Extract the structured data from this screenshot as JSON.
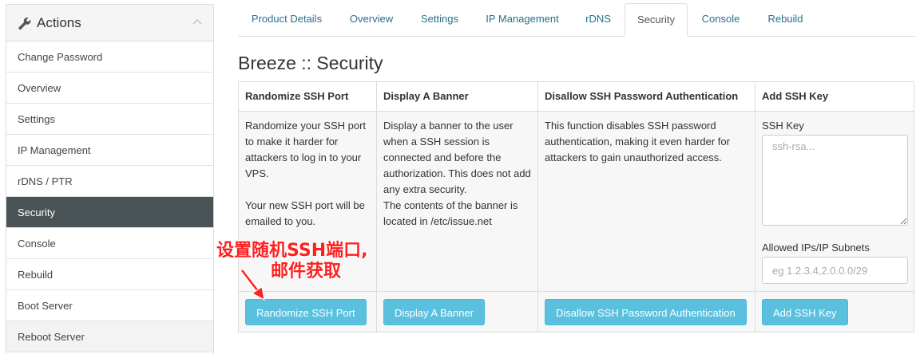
{
  "sidebar": {
    "title": "Actions",
    "items": [
      {
        "label": "Change Password"
      },
      {
        "label": "Overview"
      },
      {
        "label": "Settings"
      },
      {
        "label": "IP Management"
      },
      {
        "label": "rDNS / PTR"
      },
      {
        "label": "Security"
      },
      {
        "label": "Console"
      },
      {
        "label": "Rebuild"
      },
      {
        "label": "Boot Server"
      },
      {
        "label": "Reboot Server"
      }
    ],
    "active_index": 5
  },
  "tabs": [
    {
      "label": "Product Details"
    },
    {
      "label": "Overview"
    },
    {
      "label": "Settings"
    },
    {
      "label": "IP Management"
    },
    {
      "label": "rDNS"
    },
    {
      "label": "Security"
    },
    {
      "label": "Console"
    },
    {
      "label": "Rebuild"
    }
  ],
  "active_tab": "Security",
  "page_title": "Breeze :: Security",
  "columns": {
    "randomize": {
      "header": "Randomize SSH Port",
      "para1": "Randomize your SSH port to make it harder for attackers to log in to your VPS.",
      "para2": "Your new SSH port will be emailed to you.",
      "button": "Randomize SSH Port"
    },
    "banner": {
      "header": "Display A Banner",
      "para1": "Display a banner to the user when a SSH session is connected and before the authorization. This does not add any extra security.",
      "para2": "The contents of the banner is located in /etc/issue.net",
      "button": "Display A Banner"
    },
    "disallow": {
      "header": "Disallow SSH Password Authentication",
      "para1": "This function disables SSH password authentication, making it even harder for attackers to gain unauthorized access.",
      "button": "Disallow SSH Password Authentication"
    },
    "addkey": {
      "header": "Add SSH Key",
      "ssh_label": "SSH Key",
      "ssh_placeholder": "ssh-rsa...",
      "ssh_value": "",
      "ips_label": "Allowed IPs/IP Subnets",
      "ips_placeholder": "eg 1.2.3.4,2.0.0.0/29",
      "ips_value": "",
      "button": "Add SSH Key"
    }
  },
  "annotation": {
    "line1": "设置随机SSH端口,",
    "line2": "邮件获取",
    "color": "#ff1f1f"
  },
  "colors": {
    "accent_button": "#5bc0de",
    "sidebar_active": "#4a5356",
    "link": "#2a6f8e"
  },
  "icons": {
    "header_icon": "wrench-icon",
    "collapse_icon": "chevron-up-icon"
  }
}
